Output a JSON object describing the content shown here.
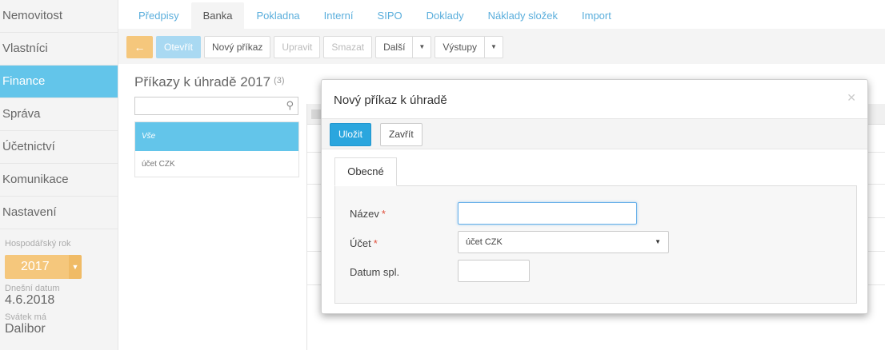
{
  "sidebar": {
    "items": [
      {
        "label": "Nemovitost"
      },
      {
        "label": "Vlastníci"
      },
      {
        "label": "Finance"
      },
      {
        "label": "Správa"
      },
      {
        "label": "Účetnictví"
      },
      {
        "label": "Komunikace"
      },
      {
        "label": "Nastavení"
      }
    ],
    "fiscal_year_label": "Hospodářský rok",
    "fiscal_year_value": "2017",
    "today_label": "Dnešní datum",
    "today_value": "4.6.2018",
    "holiday_label": "Svátek má",
    "holiday_value": "Dalibor"
  },
  "tabs": [
    "Předpisy",
    "Banka",
    "Pokladna",
    "Interní",
    "SIPO",
    "Doklady",
    "Náklady složek",
    "Import"
  ],
  "toolbar": {
    "back_icon": "←",
    "open": "Otevřít",
    "new_order": "Nový příkaz",
    "edit": "Upravit",
    "delete": "Smazat",
    "more": "Další",
    "outputs": "Výstupy"
  },
  "page": {
    "title": "Příkazy k úhradě 2017",
    "count": "(3)"
  },
  "list": {
    "items": [
      "Vše",
      "účet CZK"
    ]
  },
  "modal": {
    "title": "Nový příkaz k úhradě",
    "save": "Uložit",
    "close": "Zavřít",
    "tab": "Obecné",
    "fields": {
      "name_label": "Název",
      "account_label": "Účet",
      "account_value": "účet CZK",
      "due_label": "Datum spl.",
      "required_mark": "*"
    }
  },
  "colors": {
    "active_blue": "#63c5ea",
    "primary_button": "#2ba6de",
    "orange": "#f5c77c",
    "link": "#5aaedc",
    "required": "#e0503c"
  },
  "icons": {
    "search": "search-icon",
    "close": "close-icon",
    "caret": "chevron-down-icon",
    "back": "arrow-left-icon"
  }
}
